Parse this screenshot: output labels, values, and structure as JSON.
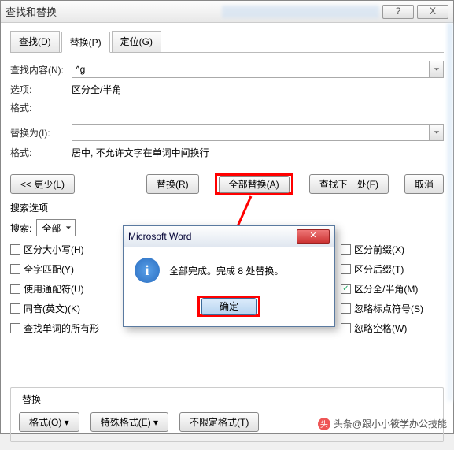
{
  "window": {
    "title": "查找和替换"
  },
  "titlebar": {
    "help": "?",
    "close": "X"
  },
  "tabs": {
    "find": "查找(D)",
    "replace": "替换(P)",
    "goto": "定位(G)"
  },
  "find": {
    "label": "查找内容(N):",
    "value": "^g",
    "options_label": "选项:",
    "options_value": "区分全/半角",
    "format_label": "格式:"
  },
  "replace": {
    "label": "替换为(I):",
    "value": "",
    "format_label": "格式:",
    "format_value": "居中, 不允许文字在单词中间换行"
  },
  "buttons": {
    "less": "<< 更少(L)",
    "replace": "替换(R)",
    "replace_all": "全部替换(A)",
    "find_next": "查找下一处(F)",
    "cancel": "取消"
  },
  "search_options": {
    "title": "搜索选项",
    "search_label": "搜索:",
    "search_value": "全部",
    "left": [
      {
        "label": "区分大小写(H)",
        "checked": false
      },
      {
        "label": "全字匹配(Y)",
        "checked": false
      },
      {
        "label": "使用通配符(U)",
        "checked": false
      },
      {
        "label": "同音(英文)(K)",
        "checked": false
      },
      {
        "label": "查找单词的所有形",
        "checked": false
      }
    ],
    "right": [
      {
        "label": "区分前缀(X)",
        "checked": false
      },
      {
        "label": "区分后缀(T)",
        "checked": false
      },
      {
        "label": "区分全/半角(M)",
        "checked": true
      },
      {
        "label": "忽略标点符号(S)",
        "checked": false
      },
      {
        "label": "忽略空格(W)",
        "checked": false
      }
    ]
  },
  "replace_section": {
    "legend": "替换",
    "format": "格式(O) ▾",
    "special": "特殊格式(E) ▾",
    "no_format": "不限定格式(T)"
  },
  "msgbox": {
    "title": "Microsoft Word",
    "body": "全部完成。完成 8 处替换。",
    "ok": "确定"
  },
  "watermark": "头条@跟小小筱学办公技能"
}
